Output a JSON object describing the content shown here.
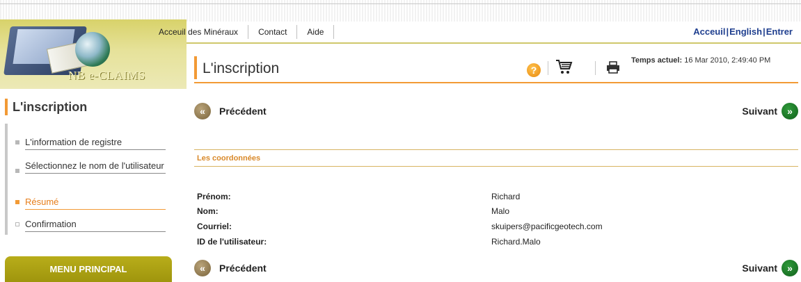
{
  "header": {
    "brand": "NB e-CLAIMS",
    "nav": [
      "Acceuil des Minéraux",
      "Contact",
      "Aide"
    ],
    "right_links": [
      "Acceuil",
      "English",
      "Entrer"
    ]
  },
  "page": {
    "title": "L'inscription",
    "time_label": "Temps actuel:",
    "time_value": "16 Mar 2010, 2:49:40 PM"
  },
  "sidebar": {
    "title": "L'inscription",
    "items": [
      {
        "label": "L'information de registre",
        "state": "done"
      },
      {
        "label": "Sélectionnez le nom de l'utilisateur",
        "state": "done"
      },
      {
        "label": "Résumé",
        "state": "active"
      },
      {
        "label": "Confirmation",
        "state": "pending"
      }
    ],
    "menu_principal": "MENU PRINCIPAL"
  },
  "pager": {
    "prev": "Précédent",
    "next": "Suivant"
  },
  "section": {
    "heading": "Les coordonnées",
    "fields": [
      {
        "label": "Prénom:",
        "value": "Richard"
      },
      {
        "label": "Nom:",
        "value": "Malo"
      },
      {
        "label": "Courriel:",
        "value": "skuipers@pacificgeotech.com"
      },
      {
        "label": "ID de l'utilisateur:",
        "value": "Richard.Malo"
      }
    ]
  },
  "colors": {
    "accent_orange": "#f29a35",
    "olive": "#b8ad1a",
    "link_blue": "#1f3f8f",
    "next_green": "#11601c"
  },
  "icons": {
    "help": "help-icon",
    "cart": "cart-icon",
    "print": "print-icon",
    "prev": "chevrons-left-icon",
    "next": "chevrons-right-icon"
  }
}
